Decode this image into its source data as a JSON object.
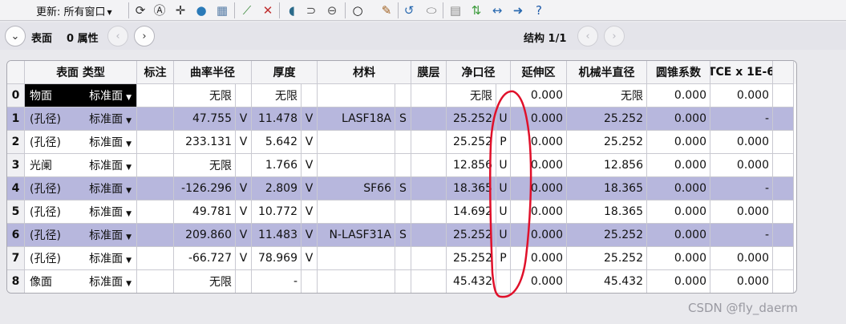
{
  "toolbar": {
    "update_label": "更新: 所有窗口",
    "icons": [
      "refresh-circle-icon",
      "refresh-a-icon",
      "crosshair-icon",
      "globe-icon",
      "image-icon",
      "ray-icon",
      "ray-x-icon",
      "lens-icon",
      "lens-arrow-icon",
      "lens-double-icon",
      "circle-icon",
      "pen-icon",
      "undo-icon",
      "toggle-icon",
      "page-icon",
      "swap-icon",
      "arrows-icon",
      "arrow-right-icon",
      "help-icon"
    ]
  },
  "header": {
    "surface_label": "表面",
    "props_label": "0 属性",
    "config_label": "结构 1/1"
  },
  "table": {
    "columns": [
      "表面 类型",
      "标注",
      "曲率半径",
      "厚度",
      "材料",
      "膜层",
      "净口径",
      "延伸区",
      "机械半直径",
      "圆锥系数",
      "TCE x 1E-6"
    ],
    "rows": [
      {
        "idx": "0",
        "name": "物面",
        "type": "标准面",
        "radius": "无限",
        "rflag": "",
        "thick": "无限",
        "tflag": "",
        "mat": "",
        "mflag": "",
        "clear": "无限",
        "cflag": "",
        "ext": "0.000",
        "mech": "无限",
        "conic": "0.000",
        "tce": "0.000"
      },
      {
        "idx": "1",
        "name": "(孔径)",
        "type": "标准面",
        "radius": "47.755",
        "rflag": "V",
        "thick": "11.478",
        "tflag": "V",
        "mat": "LASF18A",
        "mflag": "S",
        "clear": "25.252",
        "cflag": "U",
        "ext": "0.000",
        "mech": "25.252",
        "conic": "0.000",
        "tce": "-"
      },
      {
        "idx": "2",
        "name": "(孔径)",
        "type": "标准面",
        "radius": "233.131",
        "rflag": "V",
        "thick": "5.642",
        "tflag": "V",
        "mat": "",
        "mflag": "",
        "clear": "25.252",
        "cflag": "P",
        "ext": "0.000",
        "mech": "25.252",
        "conic": "0.000",
        "tce": "0.000"
      },
      {
        "idx": "3",
        "name": "光阑",
        "type": "标准面",
        "radius": "无限",
        "rflag": "",
        "thick": "1.766",
        "tflag": "V",
        "mat": "",
        "mflag": "",
        "clear": "12.856",
        "cflag": "U",
        "ext": "0.000",
        "mech": "12.856",
        "conic": "0.000",
        "tce": "0.000"
      },
      {
        "idx": "4",
        "name": "(孔径)",
        "type": "标准面",
        "radius": "-126.296",
        "rflag": "V",
        "thick": "2.809",
        "tflag": "V",
        "mat": "SF66",
        "mflag": "S",
        "clear": "18.365",
        "cflag": "U",
        "ext": "0.000",
        "mech": "18.365",
        "conic": "0.000",
        "tce": "-"
      },
      {
        "idx": "5",
        "name": "(孔径)",
        "type": "标准面",
        "radius": "49.781",
        "rflag": "V",
        "thick": "10.772",
        "tflag": "V",
        "mat": "",
        "mflag": "",
        "clear": "14.692",
        "cflag": "U",
        "ext": "0.000",
        "mech": "18.365",
        "conic": "0.000",
        "tce": "0.000"
      },
      {
        "idx": "6",
        "name": "(孔径)",
        "type": "标准面",
        "radius": "209.860",
        "rflag": "V",
        "thick": "11.483",
        "tflag": "V",
        "mat": "N-LASF31A",
        "mflag": "S",
        "clear": "25.252",
        "cflag": "U",
        "ext": "0.000",
        "mech": "25.252",
        "conic": "0.000",
        "tce": "-"
      },
      {
        "idx": "7",
        "name": "(孔径)",
        "type": "标准面",
        "radius": "-66.727",
        "rflag": "V",
        "thick": "78.969",
        "tflag": "V",
        "mat": "",
        "mflag": "",
        "clear": "25.252",
        "cflag": "P",
        "ext": "0.000",
        "mech": "25.252",
        "conic": "0.000",
        "tce": "0.000"
      },
      {
        "idx": "8",
        "name": "像面",
        "type": "标准面",
        "radius": "无限",
        "rflag": "",
        "thick": "-",
        "tflag": "",
        "mat": "",
        "mflag": "",
        "clear": "45.432",
        "cflag": "",
        "ext": "0.000",
        "mech": "45.432",
        "conic": "0.000",
        "tce": "0.000"
      }
    ]
  },
  "watermark": "CSDN @fly_daerm",
  "colors": {
    "row_highlight": "#b7b7dd",
    "annotation": "#e0102a"
  }
}
